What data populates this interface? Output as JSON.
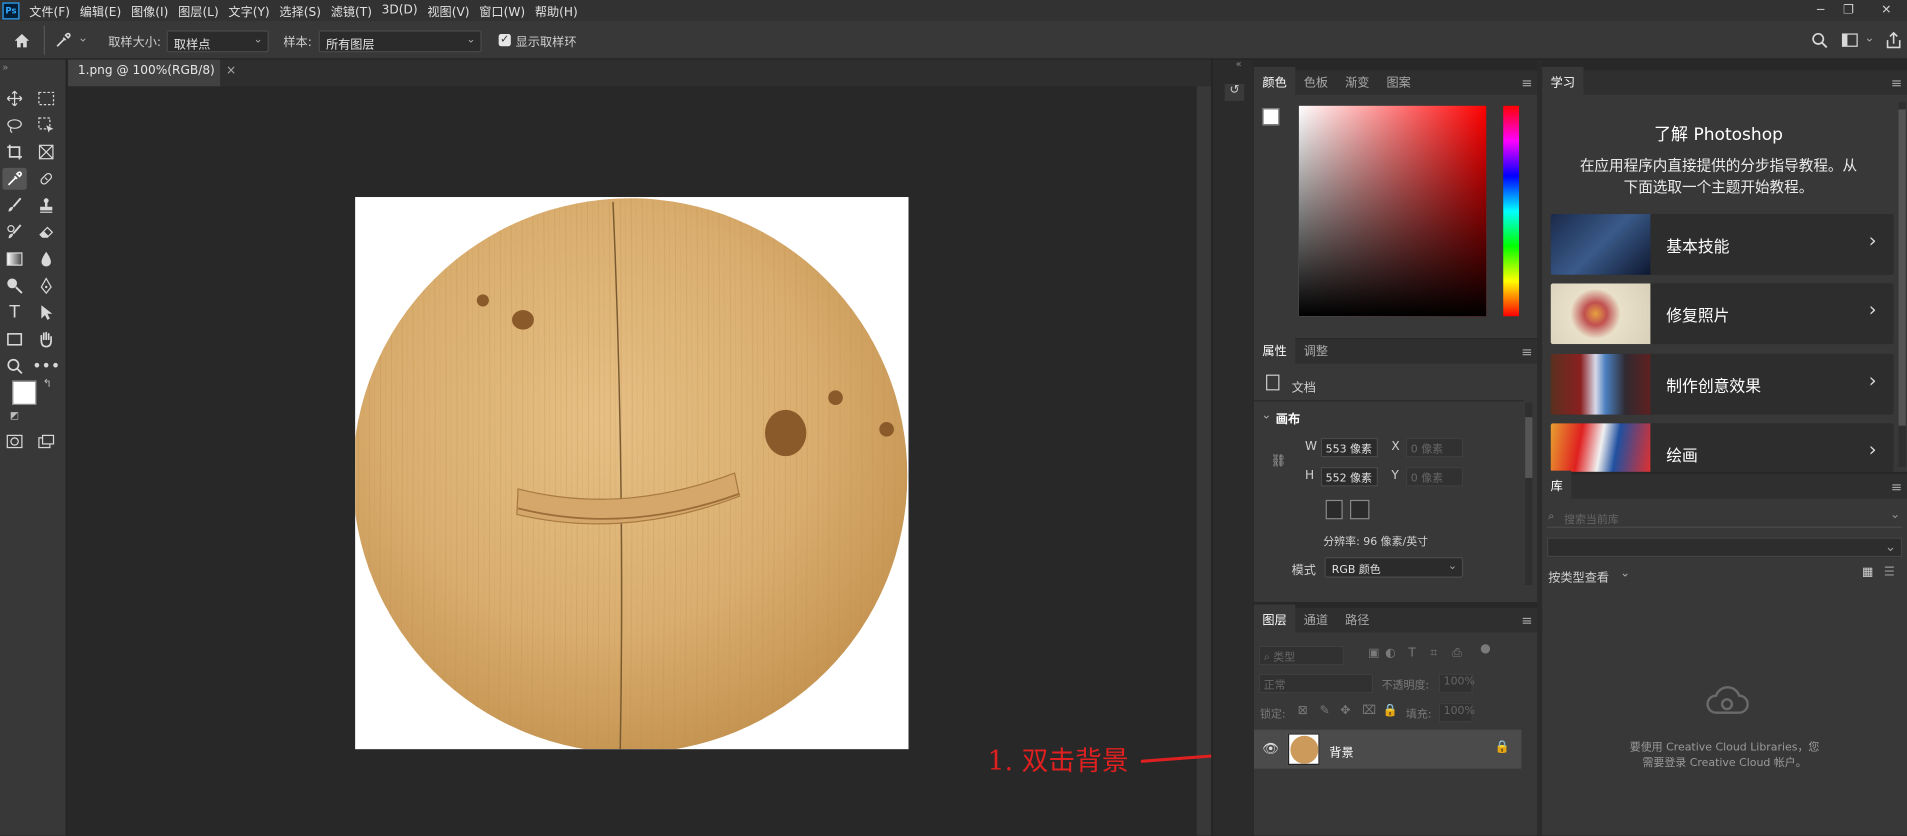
{
  "app": {
    "logo": "Ps"
  },
  "menu": [
    "文件(F)",
    "编辑(E)",
    "图像(I)",
    "图层(L)",
    "文字(Y)",
    "选择(S)",
    "滤镜(T)",
    "3D(D)",
    "视图(V)",
    "窗口(W)",
    "帮助(H)"
  ],
  "options": {
    "sample_size_label": "取样大小:",
    "sample_size_value": "取样点",
    "sample_label": "样本:",
    "sample_value": "所有图层",
    "show_ring_label": "显示取样环"
  },
  "document": {
    "tab_title": "1.png @ 100%(RGB/8)",
    "close": "×"
  },
  "color_panel": {
    "tabs": [
      "颜色",
      "色板",
      "渐变",
      "图案"
    ]
  },
  "properties_panel": {
    "tabs": [
      "属性",
      "调整"
    ],
    "doc_label": "文档",
    "canvas_section": "画布",
    "w_label": "W",
    "w_value": "553 像素",
    "h_label": "H",
    "h_value": "552 像素",
    "x_label": "X",
    "x_placeholder": "0 像素",
    "y_label": "Y",
    "y_placeholder": "0 像素",
    "resolution": "分辨率: 96 像素/英寸",
    "mode_label": "模式",
    "mode_value": "RGB 颜色"
  },
  "layers_panel": {
    "tabs": [
      "图层",
      "通道",
      "路径"
    ],
    "filter_placeholder": "类型",
    "blend_mode": "正常",
    "opacity_label": "不透明度:",
    "opacity_value": "100%",
    "lock_label": "锁定:",
    "fill_label": "填充:",
    "fill_value": "100%",
    "layer_name": "背景"
  },
  "learn_panel": {
    "tab": "学习",
    "title": "了解 Photoshop",
    "subtitle_line1": "在应用程序内直接提供的分步指导教程。从",
    "subtitle_line2": "下面选取一个主题开始教程。",
    "items": [
      {
        "label": "基本技能"
      },
      {
        "label": "修复照片"
      },
      {
        "label": "制作创意效果"
      },
      {
        "label": "绘画"
      }
    ]
  },
  "library_panel": {
    "tab": "库",
    "search_placeholder": "搜索当前库",
    "view_by": "按类型查看",
    "message_line1": "要使用 Creative Cloud Libraries，您",
    "message_line2": "需要登录 Creative Cloud 帐户。"
  },
  "annotation": {
    "text": "1. 双击背景",
    "color": "#e02020"
  },
  "icons": [
    "home-icon",
    "eyedropper-icon",
    "search-icon",
    "workspace-icon",
    "share-icon",
    "move-icon",
    "marquee-icon",
    "lasso-icon",
    "object-select-icon",
    "crop-icon",
    "frame-icon",
    "eyedropper-tool-icon",
    "healing-icon",
    "brush-icon",
    "stamp-icon",
    "history-brush-icon",
    "eraser-icon",
    "gradient-icon",
    "blur-icon",
    "dodge-icon",
    "pen-icon",
    "type-icon",
    "path-select-icon",
    "rectangle-icon",
    "hand-icon",
    "zoom-icon",
    "more-icon",
    "eye-icon",
    "lock-icon",
    "cloud-icon"
  ]
}
